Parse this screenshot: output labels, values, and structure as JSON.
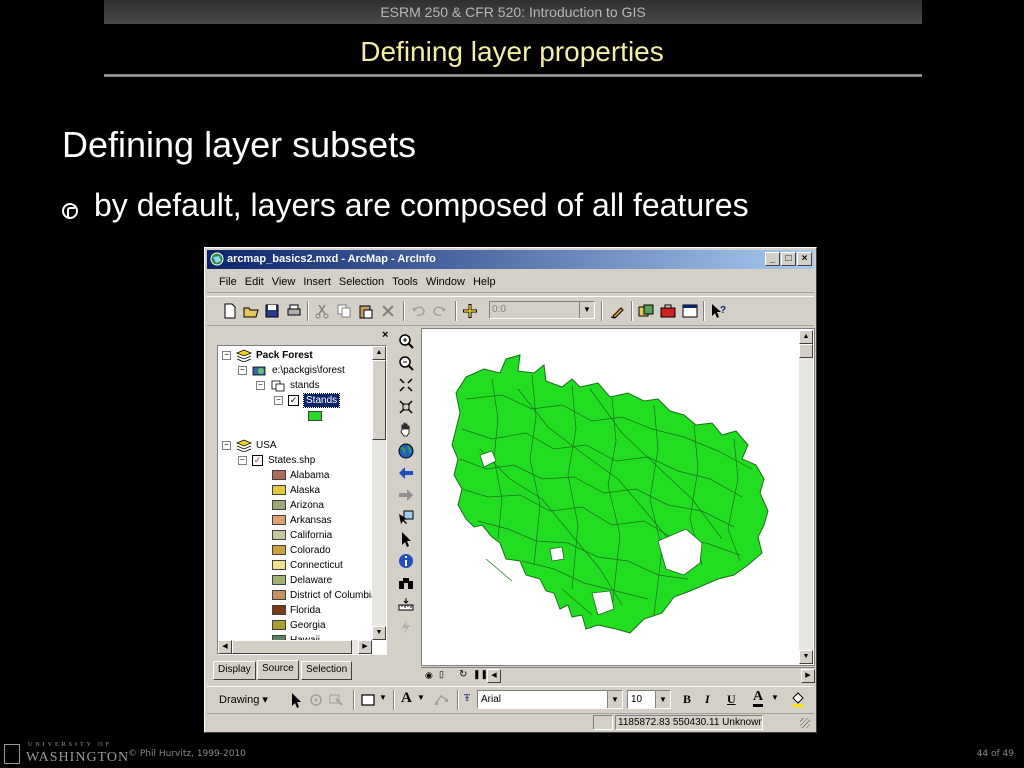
{
  "slide": {
    "header": "ESRM 250 & CFR 520: Introduction to GIS",
    "title": "Defining layer properties",
    "heading": "Defining layer subsets",
    "bullet": "by default, layers are composed of all features",
    "footer_logo_top": "UNIVERSITY OF",
    "footer_logo_name": "WASHINGTON",
    "footer_copyright": "© Phil Hurvitz, 1999-2010",
    "page_number": "44 of 49"
  },
  "window": {
    "title": "arcmap_basics2.mxd - ArcMap - ArcInfo",
    "minimize": "_",
    "maximize": "□",
    "close": "×"
  },
  "menu": [
    "File",
    "Edit",
    "View",
    "Insert",
    "Selection",
    "Tools",
    "Window",
    "Help"
  ],
  "toolbar": {
    "scale_value": "0:0"
  },
  "toc": {
    "close": "×",
    "dataframe1": "Pack Forest",
    "workspace": "e:\\packgis\\forest",
    "coverage": "stands",
    "layer": "Stands",
    "dataframe2": "USA",
    "states_layer": "States.shp",
    "states": [
      {
        "name": "Alabama",
        "color": "#b46a5a"
      },
      {
        "name": "Alaska",
        "color": "#e3c840"
      },
      {
        "name": "Arizona",
        "color": "#9aaa70"
      },
      {
        "name": "Arkansas",
        "color": "#e0a070"
      },
      {
        "name": "California",
        "color": "#c8c8a0"
      },
      {
        "name": "Colorado",
        "color": "#d0a040"
      },
      {
        "name": "Connecticut",
        "color": "#f0e090"
      },
      {
        "name": "Delaware",
        "color": "#a0b070"
      },
      {
        "name": "District of Columbia",
        "color": "#c89060"
      },
      {
        "name": "Florida",
        "color": "#7a3a1a"
      },
      {
        "name": "Georgia",
        "color": "#a8a030"
      },
      {
        "name": "Hawaii",
        "color": "#5a8060"
      }
    ],
    "tabs": [
      "Display",
      "Source",
      "Selection"
    ],
    "active_tab": "Source"
  },
  "drawing": {
    "label": "Drawing",
    "font": "Arial",
    "size": "10",
    "bold": "B",
    "italic": "I",
    "underline": "U",
    "text_tool": "A"
  },
  "status": {
    "coordinates": "1185872.83  550430.11 Unknown"
  },
  "colors": {
    "stands_fill": "#22dd22",
    "stands_outline": "#1a6e1a",
    "title_yellow": "#f3efa6"
  }
}
